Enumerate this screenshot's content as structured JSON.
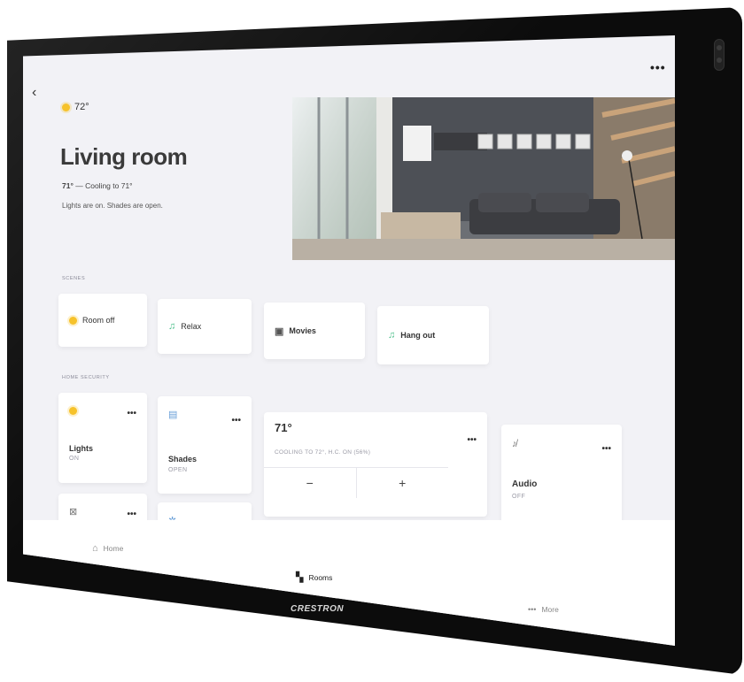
{
  "device": {
    "brand": "CRESTRON"
  },
  "header": {
    "more_icon": "•••",
    "back_icon": "‹",
    "weather_icon": "sun-icon",
    "outdoor_temp": "72°"
  },
  "room": {
    "title": "Living room",
    "current_temp": "71°",
    "status_suffix": " — Cooling to 71°",
    "description": "Lights are on. Shades are open."
  },
  "scenes": {
    "label": "SCENES",
    "items": [
      {
        "label": "Room off",
        "icon": "sun-icon"
      },
      {
        "label": "Relax",
        "icon": "music-note-icon"
      },
      {
        "label": "Movies",
        "icon": "tv-icon"
      },
      {
        "label": "Hang out",
        "icon": "music-note-icon"
      }
    ]
  },
  "security": {
    "label": "HOME SECURITY",
    "lights": {
      "title": "Lights",
      "status": "ON",
      "icon": "sun-icon"
    },
    "shades": {
      "title": "Shades",
      "status": "OPEN",
      "icon": "shade-icon"
    },
    "thermostat": {
      "value": "71°",
      "status": "COOLING TO 72°, H.C. ON (56%)",
      "minus": "−",
      "plus": "+"
    },
    "audio": {
      "title": "Audio",
      "status": "OFF",
      "icon": "speaker-muted-icon"
    },
    "row2": [
      {
        "icon": "display-off-icon"
      },
      {
        "icon": "fan-icon"
      },
      {
        "icon": "frame-icon"
      }
    ],
    "more_icon": "•••"
  },
  "nav": {
    "home": "Home",
    "rooms": "Rooms",
    "more": "More",
    "more_icon": "•••"
  },
  "colors": {
    "accent_yellow": "#f6c22b",
    "accent_green": "#4bbf8a",
    "bezel": "#0c0c0c"
  }
}
